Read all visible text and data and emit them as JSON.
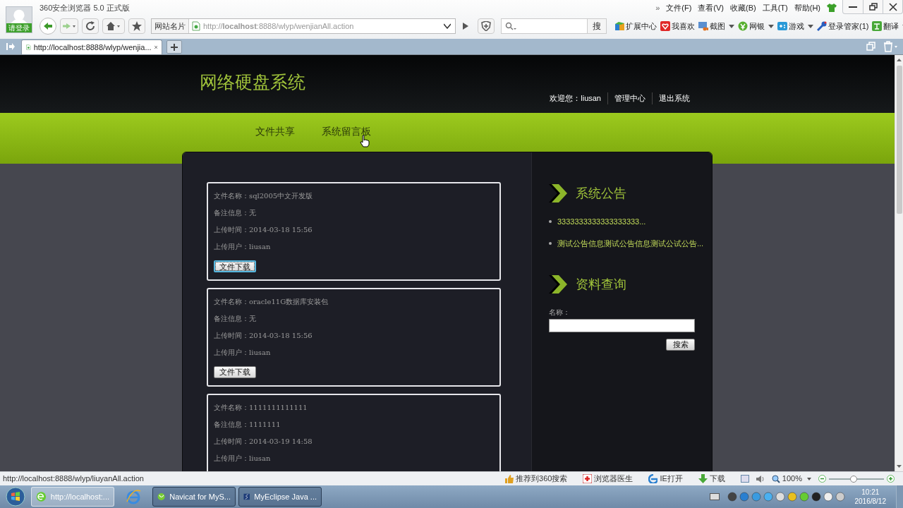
{
  "browser": {
    "title": "360安全浏览器 5.0 正式版",
    "login_label": "请登录",
    "overflow": "»",
    "menu": [
      "文件(F)",
      "查看(V)",
      "收藏(B)",
      "工具(T)",
      "帮助(H)"
    ],
    "site_card": "网站名片",
    "address": "http://**localhost**:8888/wlyp/wenjianAll.action",
    "search_button": "搜",
    "toolbar": [
      {
        "label": "扩展中心",
        "dropdown": false
      },
      {
        "label": "我喜欢",
        "dropdown": false
      },
      {
        "label": "截图",
        "dropdown": true
      },
      {
        "label": "网银",
        "dropdown": true
      },
      {
        "label": "游戏",
        "dropdown": true
      },
      {
        "label": "登录管家(1)",
        "dropdown": false
      },
      {
        "label": "翻译",
        "dropdown": true
      }
    ],
    "tabs": [
      {
        "title": "http://localhost:8888/wlyp/wenjia...",
        "selected": true
      }
    ]
  },
  "page": {
    "site_title": "网络硬盘系统",
    "welcome": "欢迎您：liusan",
    "user_links": [
      "管理中心",
      "退出系统"
    ],
    "nav": [
      "文件共享",
      "系统留言板"
    ],
    "files": [
      {
        "lines": [
          "文件名称：sql2005中文开发版",
          "备注信息：无",
          "上传时间：2014-03-18 15:56",
          "上传用户：liusan"
        ],
        "button": "文件下载",
        "focused": true
      },
      {
        "lines": [
          "文件名称：oracle11G数据库安装包",
          "备注信息：无",
          "上传时间：2014-03-18 15:56",
          "上传用户：liusan"
        ],
        "button": "文件下载",
        "focused": false
      },
      {
        "lines": [
          "文件名称：1111111111111",
          "备注信息：1111111",
          "上传时间：2014-03-19 14:58",
          "上传用户：liusan"
        ]
      }
    ],
    "notice_title": "系统公告",
    "notices": [
      "3333333333333333333...",
      "测试公告信息测试公告信息测试公试公告..."
    ],
    "search_title": "资料查询",
    "search_label": "名称：",
    "search_button": "搜索"
  },
  "status_bar": {
    "url": "http://localhost:8888/wlyp/liuyanAll.action",
    "items": [
      "推荐到360搜索",
      "浏览器医生",
      "IE打开",
      "下载"
    ],
    "zoom": "100%",
    "zoom_slider": {
      "level": 0.45
    }
  },
  "taskbar": {
    "items": [
      {
        "label": "http://localhost:...",
        "selected": true
      },
      {
        "label": "Navicat for MyS...",
        "selected": false
      },
      {
        "label": "MyEclipse Java ...",
        "selected": false
      }
    ],
    "time": "10:21",
    "date": "2016/8/12"
  }
}
